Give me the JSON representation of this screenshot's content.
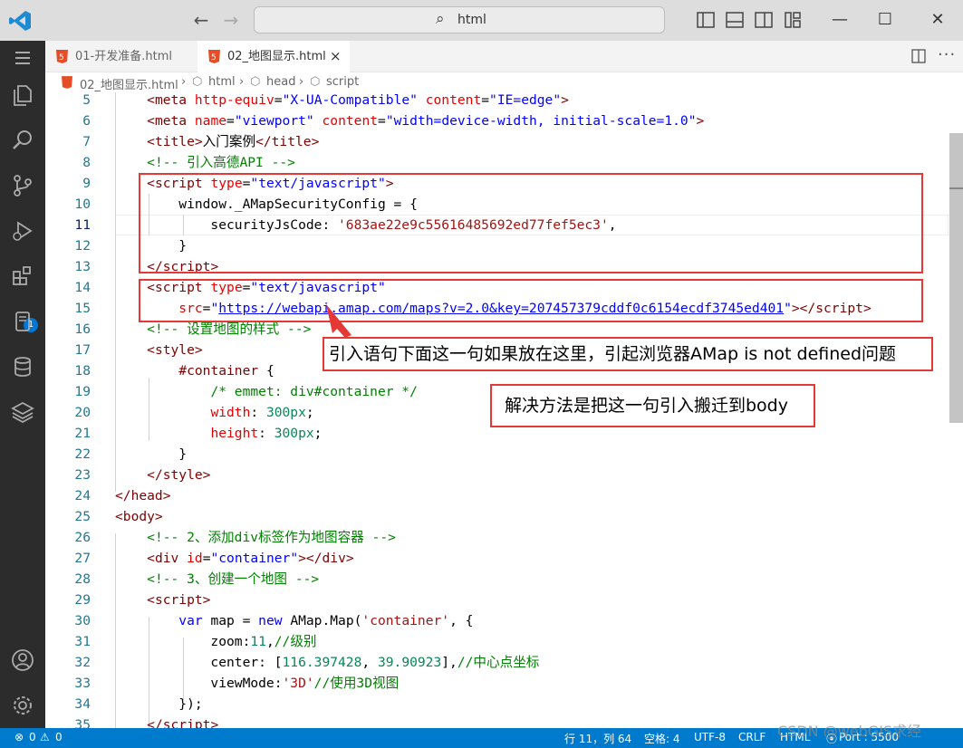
{
  "titlebar": {
    "search_text": "html",
    "icons": [
      "vscode-logo-icon",
      "back-arrow-icon",
      "forward-arrow-icon",
      "search-icon",
      "toggle-primary-sidebar-icon",
      "toggle-panel-icon",
      "toggle-secondary-sidebar-icon",
      "customize-layout-icon",
      "minimize-icon",
      "maximize-icon",
      "close-window-icon"
    ]
  },
  "activity_bar": {
    "items": [
      "menu-icon",
      "explorer-icon",
      "search-icon",
      "source-control-icon",
      "run-debug-icon",
      "extensions-icon",
      "notebook-icon",
      "database-icon",
      "layers-icon",
      "account-icon",
      "settings-gear-icon"
    ],
    "extensions_badge": "1"
  },
  "tabs": [
    {
      "label": "01-开发准备.html",
      "active": false
    },
    {
      "label": "02_地图显示.html",
      "active": true,
      "close": "×"
    }
  ],
  "breadcrumb": {
    "file": "02_地图显示.html",
    "items": [
      "html",
      "head",
      "script"
    ],
    "sep": "›"
  },
  "editor": {
    "current_line": 11,
    "lines": [
      {
        "n": "5"
      },
      {
        "n": "6"
      },
      {
        "n": "7"
      },
      {
        "n": "8"
      },
      {
        "n": "9"
      },
      {
        "n": "10"
      },
      {
        "n": "11"
      },
      {
        "n": "12"
      },
      {
        "n": "13"
      },
      {
        "n": "14"
      },
      {
        "n": "15"
      },
      {
        "n": "16"
      },
      {
        "n": "17"
      },
      {
        "n": "18"
      },
      {
        "n": "19"
      },
      {
        "n": "20"
      },
      {
        "n": "21"
      },
      {
        "n": "22"
      },
      {
        "n": "23"
      },
      {
        "n": "24"
      },
      {
        "n": "25"
      },
      {
        "n": "26"
      },
      {
        "n": "27"
      },
      {
        "n": "28"
      },
      {
        "n": "29"
      },
      {
        "n": "30"
      },
      {
        "n": "31"
      },
      {
        "n": "32"
      },
      {
        "n": "33"
      },
      {
        "n": "34"
      },
      {
        "n": "35"
      }
    ]
  },
  "annotations": {
    "callout_1": "引入语句下面这一句如果放在这里，引起浏览器AMap is not defined问题",
    "callout_2": "解决方法是把这一句引入搬迁到body",
    "color": "#e53935"
  },
  "statusbar": {
    "errors": "0",
    "warnings": "0",
    "position": "行 11，列 64",
    "spaces": "空格: 4",
    "encoding": "UTF-8",
    "eol": "CRLF",
    "language": "HTML",
    "port": "Port : 5500",
    "watermark": "CSDN @webGIS求经",
    "color": "#007acc"
  }
}
